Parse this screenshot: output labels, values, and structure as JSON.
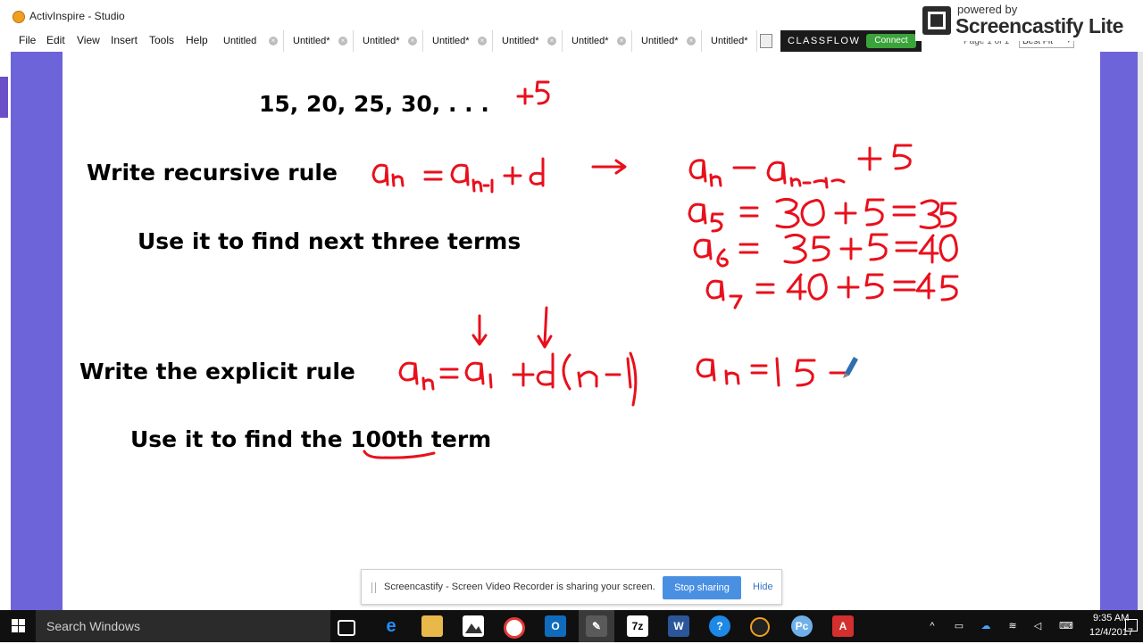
{
  "window": {
    "title": "ActivInspire - Studio"
  },
  "menubar": {
    "items": [
      "File",
      "Edit",
      "View",
      "Insert",
      "Tools",
      "Help"
    ]
  },
  "tabs": [
    "Untitled",
    "Untitled*",
    "Untitled*",
    "Untitled*",
    "Untitled*",
    "Untitled*",
    "Untitled*",
    "Untitled*"
  ],
  "classflow": {
    "label": "CLASSFLOW",
    "connect": "Connect"
  },
  "page_nav": {
    "page_info": "Page 1 of 1",
    "zoom": "Best Fit"
  },
  "watermark": {
    "powered": "powered by",
    "name": "Screencastify Lite"
  },
  "slide": {
    "sequence": "15, 20, 25, 30, . . .",
    "recursive_prompt": "Write recursive rule",
    "next_terms_prompt": "Use it to find next three terms",
    "explicit_prompt": "Write the explicit rule",
    "find_prefix": "Use it to find the",
    "find_target": "100th",
    "find_suffix": "term"
  },
  "ink": {
    "color": "#e8101c",
    "difference": "+5",
    "recursive_formula": "aₙ = aₙ₋₁ + d",
    "applied_rule": "aₙ = aₙ₋₁ + 5",
    "term_a5": "a₅ = 30 + 5 = 35",
    "term_a6": "a₆ = 35 + 5 = 40",
    "term_a7": "a₇ = 40 + 5 = 45",
    "explicit_formula": "aₙ = a₁ + d(n − 1)",
    "explicit_partial": "aₙ = 15 +"
  },
  "sharebar": {
    "message": "Screencastify - Screen Video Recorder is sharing your screen.",
    "stop": "Stop sharing",
    "hide": "Hide"
  },
  "taskbar": {
    "search": "Search Windows",
    "time": "9:35 AM",
    "date": "12/4/2017"
  },
  "colors": {
    "side_panel": "#6c64d8",
    "taskbar": "#101010",
    "stop_button": "#4a90e2",
    "classflow_connect": "#3aa33a"
  }
}
